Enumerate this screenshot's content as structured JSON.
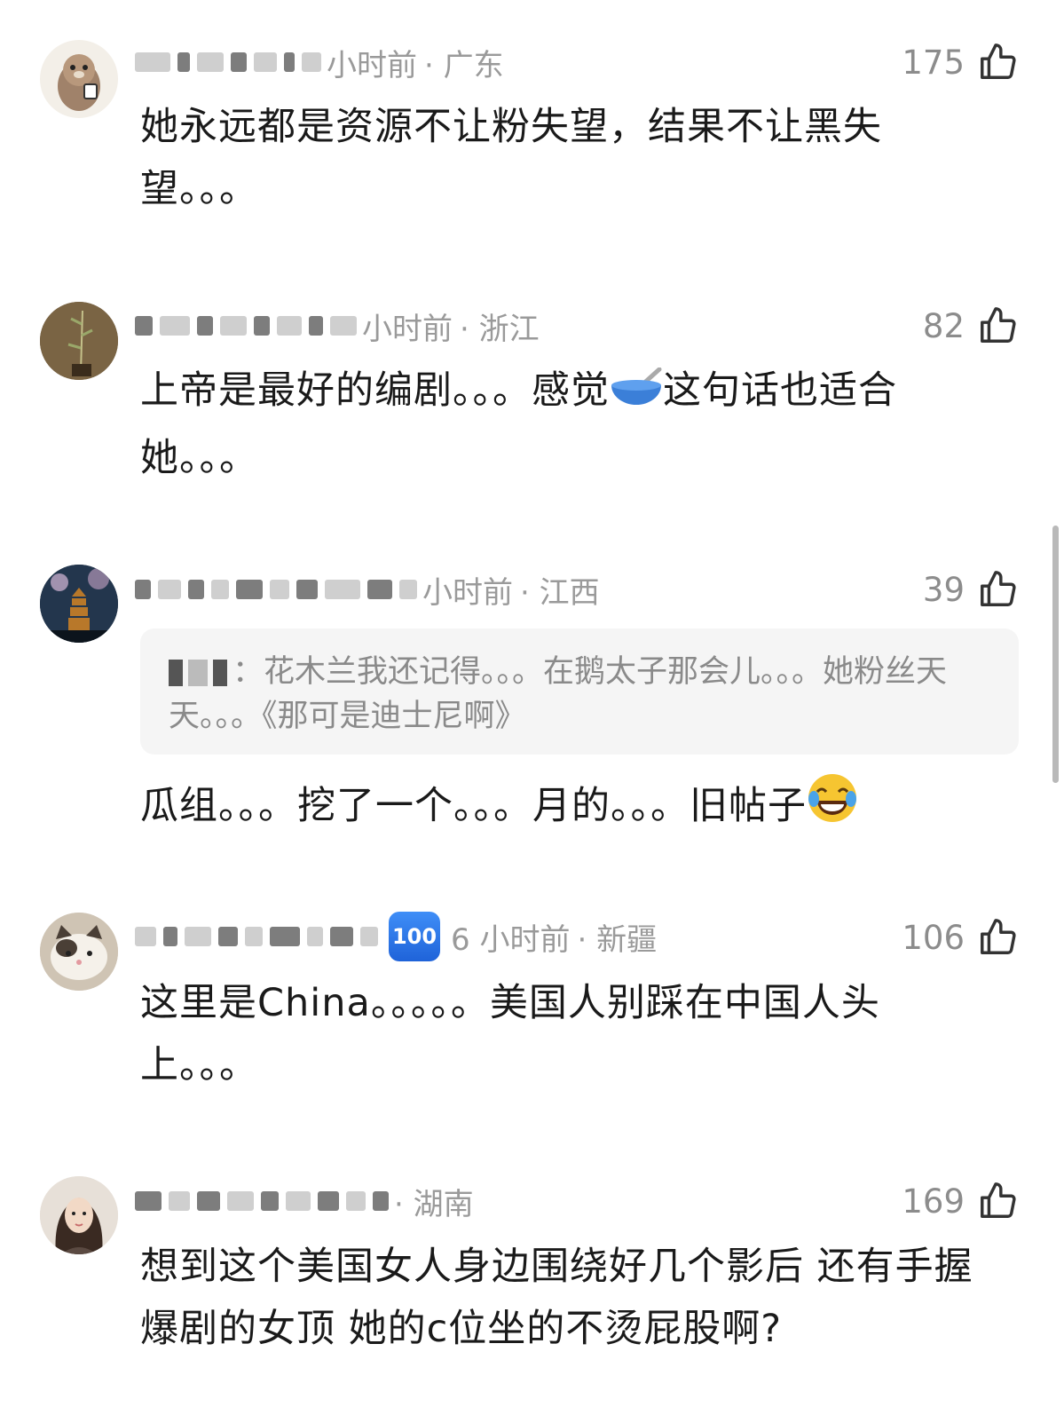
{
  "comments": [
    {
      "time": "小时前",
      "region": "· 广东",
      "likes": "175",
      "text": "她永远都是资源不让粉失望，结果不让黑失望。。。",
      "avatar": "otter-avatar"
    },
    {
      "time": "小时前",
      "region": "· 浙江",
      "likes": "82",
      "text_before": "上帝是最好的编剧。。。感觉",
      "emoji": "bowl-emoji",
      "text_after": "这句话也适合她。。。",
      "avatar": "bamboo-avatar"
    },
    {
      "time": "小时前",
      "region": "· 江西",
      "likes": "39",
      "quote": "：花木兰我还记得。。。在鹅太子那会儿。。。她粉丝天天。。。《那可是迪士尼啊》",
      "text": "瓜组。。。挖了一个。。。月的。。。旧帖子",
      "emoji": "laughing-emoji",
      "avatar": "pagoda-avatar"
    },
    {
      "badge": "100",
      "time": "6 小时前",
      "region": "· 新疆",
      "likes": "106",
      "text": "这里是China。。。。。美国人别踩在中国人头上。。。",
      "avatar": "cat-avatar"
    },
    {
      "region": "· 湖南",
      "likes": "169",
      "text": "想到这个美国女人身边围绕好几个影后 还有手握爆剧的女顶 她的c位坐的不烫屁股啊?",
      "avatar": "girl-avatar"
    }
  ],
  "colors": {
    "meta": "#9a9a9a",
    "text": "#1a1a1a",
    "quote_bg": "#f5f5f5",
    "badge": "#2f7cf0"
  }
}
